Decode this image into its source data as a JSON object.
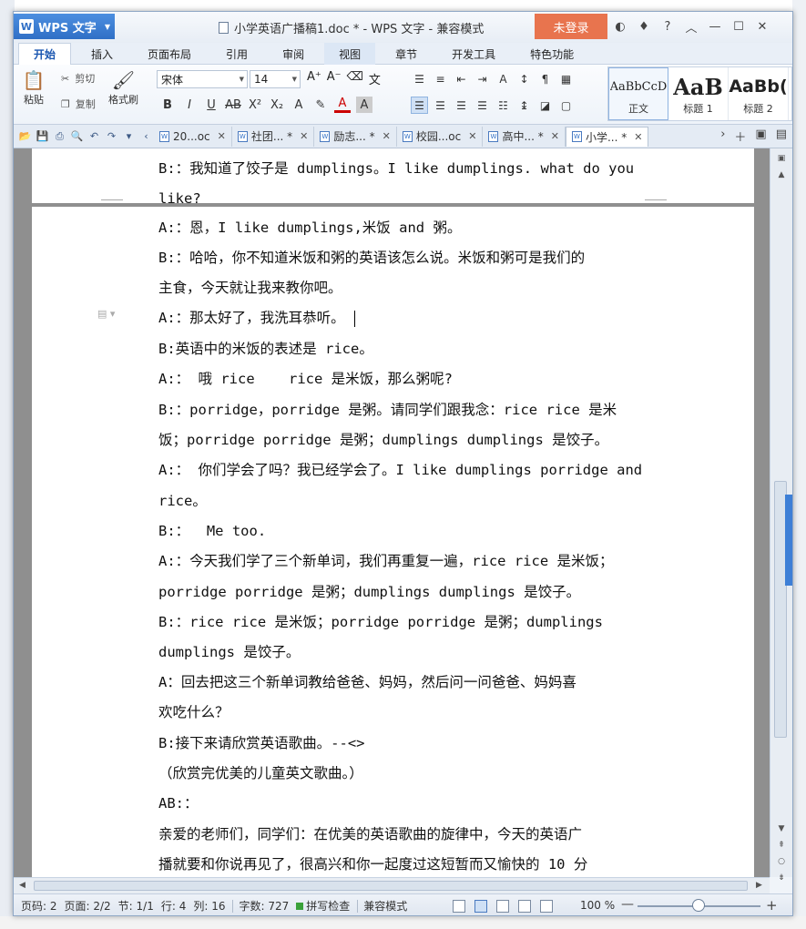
{
  "window": {
    "app_name": "WPS 文字",
    "title": "小学英语广播稿1.doc * - WPS 文字 - 兼容模式",
    "login_label": "未登录"
  },
  "menu": {
    "tabs": [
      "开始",
      "插入",
      "页面布局",
      "引用",
      "审阅",
      "视图",
      "章节",
      "开发工具",
      "特色功能"
    ]
  },
  "ribbon": {
    "paste_label": "粘贴",
    "cut_label": "剪切",
    "copy_label": "复制",
    "format_painter_label": "格式刷",
    "font_name": "宋体",
    "font_size": "14",
    "styles": [
      {
        "sample": "AaBbCcD",
        "caption": "正文"
      },
      {
        "sample": "AaB",
        "caption": "标题 1"
      },
      {
        "sample": "AaBb(",
        "caption": "标题 2"
      }
    ]
  },
  "doc_tabs": [
    "20...oc",
    "社团... *",
    "励志... *",
    "校园...oc",
    "高中... *",
    "小学... *"
  ],
  "document": {
    "lines_page1": [
      "B:：我知道了饺子是 dumplings。I like dumplings. what do you",
      "like?"
    ],
    "lines_page2": [
      "A:：恩，I like dumplings,米饭 and 粥。",
      "B:：哈哈，你不知道米饭和粥的英语该怎么说。米饭和粥可是我们的",
      "主食，今天就让我来教你吧。",
      "A:：那太好了，我洗耳恭听。",
      "B:英语中的米饭的表述是 rice。",
      "A:： 哦 rice    rice 是米饭，那么粥呢?",
      "B:：porridge，porridge 是粥。请同学们跟我念：rice rice 是米",
      "饭；porridge porridge 是粥；dumplings dumplings 是饺子。",
      "A:： 你们学会了吗？我已经学会了。I like dumplings porridge and",
      "rice。",
      "B:：  Me too.",
      "A:：今天我们学了三个新单词，我们再重复一遍，rice rice 是米饭；",
      "porridge porridge 是粥；dumplings dumplings 是饺子。",
      "B:：rice rice 是米饭；porridge porridge 是粥；dumplings",
      "dumplings 是饺子。",
      "A：回去把这三个新单词教给爸爸、妈妈，然后问一问爸爸、妈妈喜",
      "欢吃什么？",
      "B:接下来请欣赏英语歌曲。--<>",
      "（欣赏完优美的儿童英文歌曲。）",
      "AB:：",
      "亲爱的老师们，同学们：在优美的英语歌曲的旋律中，今天的英语广",
      "播就要和你说再见了，很高兴和你一起度过这短暂而又愉快的 10 分"
    ]
  },
  "status": {
    "page_code": "页码: 2",
    "pages": "页面: 2/2",
    "section": "节: 1/1",
    "row": "行: 4",
    "column": "列: 16",
    "word_count": "字数: 727",
    "spell_check": "拼写检查",
    "mode": "兼容模式",
    "zoom": "100 %"
  }
}
